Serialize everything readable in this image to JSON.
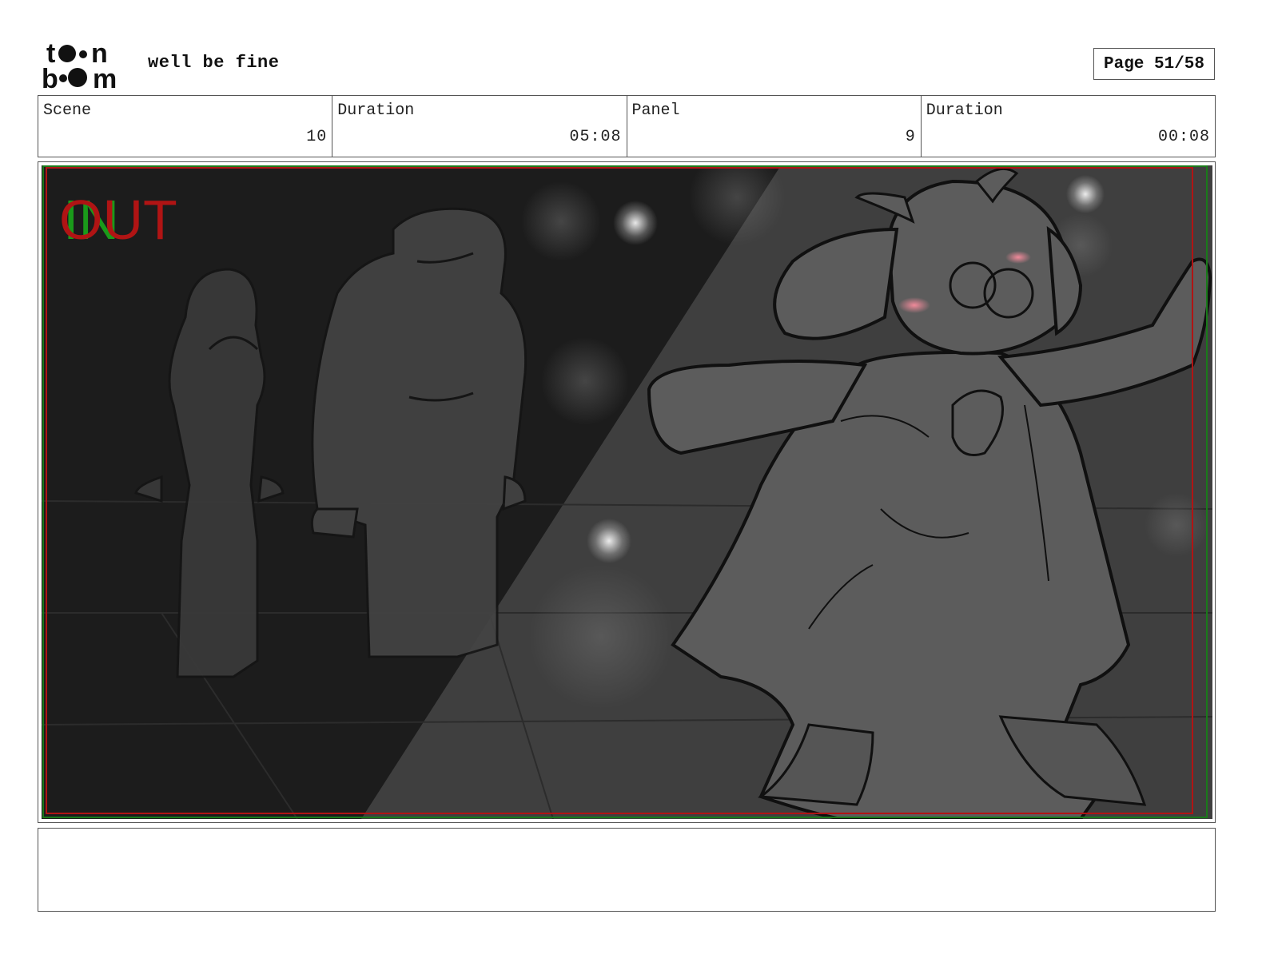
{
  "header": {
    "logo_text": "toon boom",
    "project_title": "well be fine",
    "page_label": "Page 51/58"
  },
  "info": {
    "scene_label": "Scene",
    "scene_value": "10",
    "scene_duration_label": "Duration",
    "scene_duration_value": "05:08",
    "panel_label": "Panel",
    "panel_value": "9",
    "panel_duration_label": "Duration",
    "panel_duration_value": "00:08"
  },
  "panel": {
    "overlay_in": "IN",
    "overlay_out": "OUT",
    "colors": {
      "background": "#1c1c1c",
      "light_beam": "#3f3f3f",
      "in_text": "#1a9a1a",
      "out_text": "#b01414",
      "blush": "#e87a8a",
      "figure_fill": "#5c5c5c",
      "sketch_line": "#101010"
    }
  },
  "notes": {
    "text": ""
  }
}
